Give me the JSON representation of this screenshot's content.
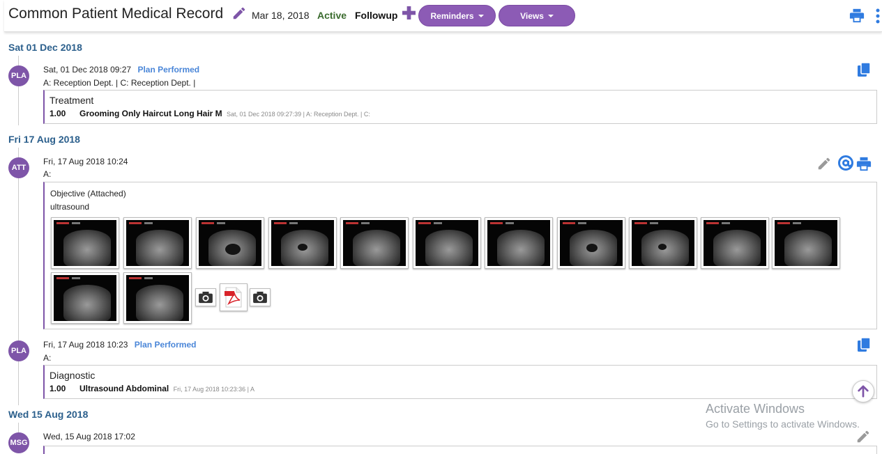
{
  "header": {
    "title": "Common Patient Medical Record",
    "date": "Mar 18, 2018",
    "status": "Active",
    "followup": "Followup",
    "reminders_label": "Reminders",
    "views_label": "Views"
  },
  "colors": {
    "accent": "#7e55a8",
    "link_blue": "#4a86d8",
    "date_blue": "#2b5f8c",
    "status_green": "#3a6b2e"
  },
  "timeline": {
    "day1": {
      "date": "Sat 01 Dec 2018",
      "entry": {
        "avatar": "PLA",
        "timestamp": "Sat, 01 Dec 2018 09:27",
        "tag": "Plan Performed",
        "meta": "A: Reception Dept. | C: Reception Dept. |",
        "card_title": "Treatment",
        "qty": "1.00",
        "item": "Grooming Only Haircut Long Hair M",
        "item_sub": "Sat, 01 Dec 2018 09:27:39 | A: Reception Dept. | C:"
      }
    },
    "day2": {
      "date": "Fri 17 Aug 2018",
      "entry1": {
        "avatar": "ATT",
        "timestamp": "Fri, 17 Aug 2018 10:24",
        "meta": "A:",
        "card_title": "Objective (Attached)",
        "card_sub": "ultrasound"
      },
      "entry2": {
        "avatar": "PLA",
        "timestamp": "Fri, 17 Aug 2018 10:23",
        "tag": "Plan Performed",
        "meta": "A:",
        "card_title": "Diagnostic",
        "qty": "1.00",
        "item": "Ultrasound Abdominal",
        "item_sub": "Fri, 17 Aug 2018 10:23:36 | A"
      }
    },
    "day3": {
      "date": "Wed 15 Aug 2018",
      "entry": {
        "avatar": "MSG",
        "timestamp": "Wed, 15 Aug 2018 17:02"
      }
    }
  },
  "watermark": {
    "line1": "Activate Windows",
    "line2": "Go to Settings to activate Windows."
  }
}
